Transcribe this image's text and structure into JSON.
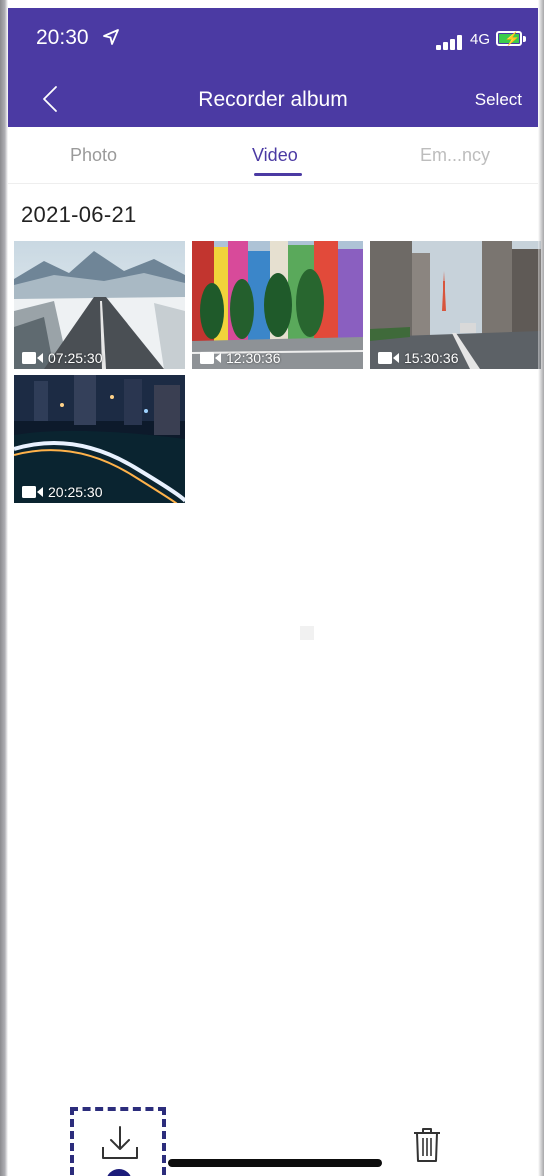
{
  "status": {
    "time": "20:30",
    "network": "4G"
  },
  "nav": {
    "title": "Recorder album",
    "select_label": "Select"
  },
  "tabs": {
    "photo": "Photo",
    "video": "Video",
    "emergency": "Em...ncy",
    "active": "Video"
  },
  "date_group": "2021-06-21",
  "videos": [
    {
      "time": "07:25:30",
      "icon": "video-camera-icon"
    },
    {
      "time": "12:30:36",
      "icon": "video-camera-icon"
    },
    {
      "time": "15:30:36",
      "icon": "video-camera-icon"
    },
    {
      "time": "20:25:30",
      "icon": "video-camera-icon"
    }
  ],
  "toolbar": {
    "download_icon": "download-icon",
    "delete_icon": "trash-icon"
  },
  "colors": {
    "accent": "#4b3aa3",
    "battery": "#3ccd4b",
    "download_box": "#2c2d7c"
  }
}
